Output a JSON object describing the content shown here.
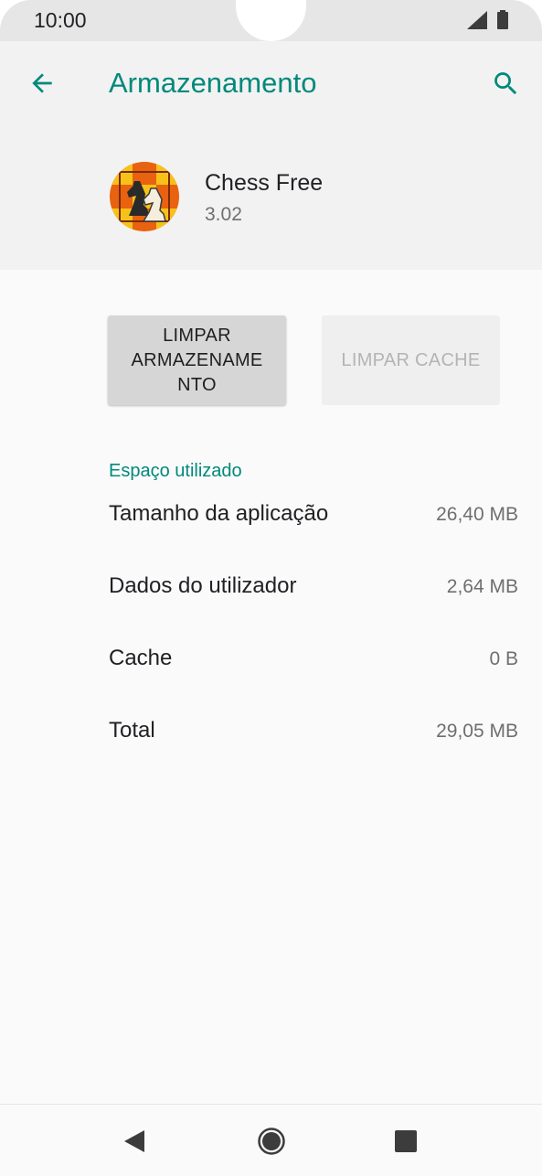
{
  "status_bar": {
    "time": "10:00"
  },
  "header": {
    "title": "Armazenamento",
    "back_icon": "arrow-left-icon",
    "search_icon": "search-icon"
  },
  "app": {
    "name": "Chess Free",
    "version": "3.02",
    "icon": "chess-knight-icon"
  },
  "buttons": {
    "clear_storage_line1": "LIMPAR",
    "clear_storage_line2": "ARMAZENAME",
    "clear_storage_line3": "NTO",
    "clear_cache": "LIMPAR CACHE"
  },
  "storage": {
    "section_title": "Espaço utilizado",
    "rows": [
      {
        "label": "Tamanho da aplicação",
        "value": "26,40 MB"
      },
      {
        "label": "Dados do utilizador",
        "value": "2,64 MB"
      },
      {
        "label": "Cache",
        "value": "0 B"
      },
      {
        "label": "Total",
        "value": "29,05 MB"
      }
    ]
  },
  "colors": {
    "accent": "#00897b",
    "header_bg": "#f2f2f2",
    "page_bg": "#fafafa",
    "button_bg": "#d6d6d6",
    "button_disabled_text": "#b4b4b4"
  },
  "nav_bar": {
    "back_icon": "nav-back-icon",
    "home_icon": "nav-home-icon",
    "recents_icon": "nav-recents-icon"
  }
}
